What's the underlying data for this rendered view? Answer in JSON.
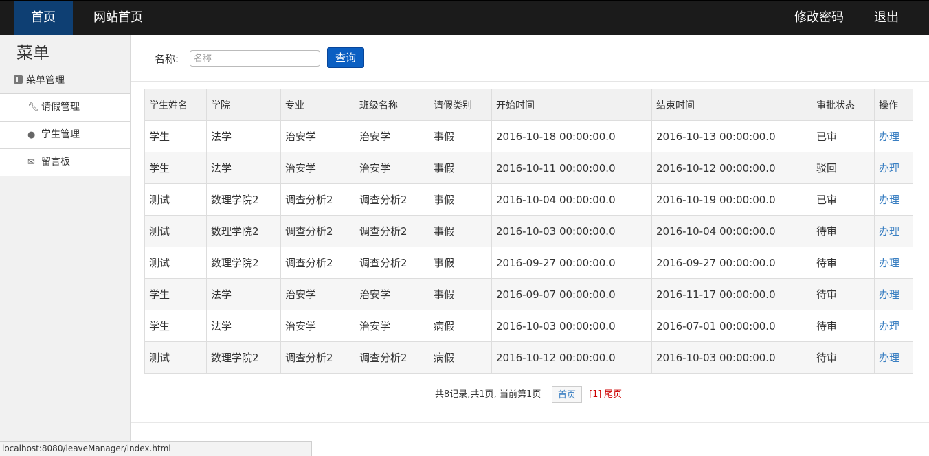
{
  "nav": {
    "home": "首页",
    "site_home": "网站首页",
    "change_password": "修改密码",
    "logout": "退出"
  },
  "sidebar": {
    "title": "菜单",
    "group": "菜单管理",
    "items": [
      {
        "label": "请假管理",
        "icon": "wrench-icon"
      },
      {
        "label": "学生管理",
        "icon": "comment-icon"
      },
      {
        "label": "留言板",
        "icon": "envelope-icon"
      }
    ]
  },
  "search": {
    "label": "名称:",
    "placeholder": "名称",
    "button": "查询"
  },
  "table": {
    "headers": [
      "学生姓名",
      "学院",
      "专业",
      "班级名称",
      "请假类别",
      "开始时间",
      "结束时间",
      "审批状态",
      "操作"
    ],
    "rows": [
      [
        "学生",
        "法学",
        "治安学",
        "治安学",
        "事假",
        "2016-10-18 00:00:00.0",
        "2016-10-13 00:00:00.0",
        "已审",
        "办理"
      ],
      [
        "学生",
        "法学",
        "治安学",
        "治安学",
        "事假",
        "2016-10-11 00:00:00.0",
        "2016-10-12 00:00:00.0",
        "驳回",
        "办理"
      ],
      [
        "测试",
        "数理学院2",
        "调查分析2",
        "调查分析2",
        "事假",
        "2016-10-04 00:00:00.0",
        "2016-10-19 00:00:00.0",
        "已审",
        "办理"
      ],
      [
        "测试",
        "数理学院2",
        "调查分析2",
        "调查分析2",
        "事假",
        "2016-10-03 00:00:00.0",
        "2016-10-04 00:00:00.0",
        "待审",
        "办理"
      ],
      [
        "测试",
        "数理学院2",
        "调查分析2",
        "调查分析2",
        "事假",
        "2016-09-27 00:00:00.0",
        "2016-09-27 00:00:00.0",
        "待审",
        "办理"
      ],
      [
        "学生",
        "法学",
        "治安学",
        "治安学",
        "事假",
        "2016-09-07 00:00:00.0",
        "2016-11-17 00:00:00.0",
        "待审",
        "办理"
      ],
      [
        "学生",
        "法学",
        "治安学",
        "治安学",
        "病假",
        "2016-10-03 00:00:00.0",
        "2016-07-01 00:00:00.0",
        "待审",
        "办理"
      ],
      [
        "测试",
        "数理学院2",
        "调查分析2",
        "调查分析2",
        "病假",
        "2016-10-12 00:00:00.0",
        "2016-10-03 00:00:00.0",
        "待审",
        "办理"
      ]
    ]
  },
  "pager": {
    "info": "共8记录,共1页, 当前第1页",
    "first": "首页",
    "current": "[1]",
    "last": "尾页"
  },
  "statusbar": {
    "url": "localhost:8080/leaveManager/index.html"
  },
  "colors": {
    "navbar": "#1b1b1b",
    "nav_active": "#0e3f73",
    "button": "#0b5fc2",
    "link": "#3a7fc2",
    "pager_current": "#cc0000"
  }
}
